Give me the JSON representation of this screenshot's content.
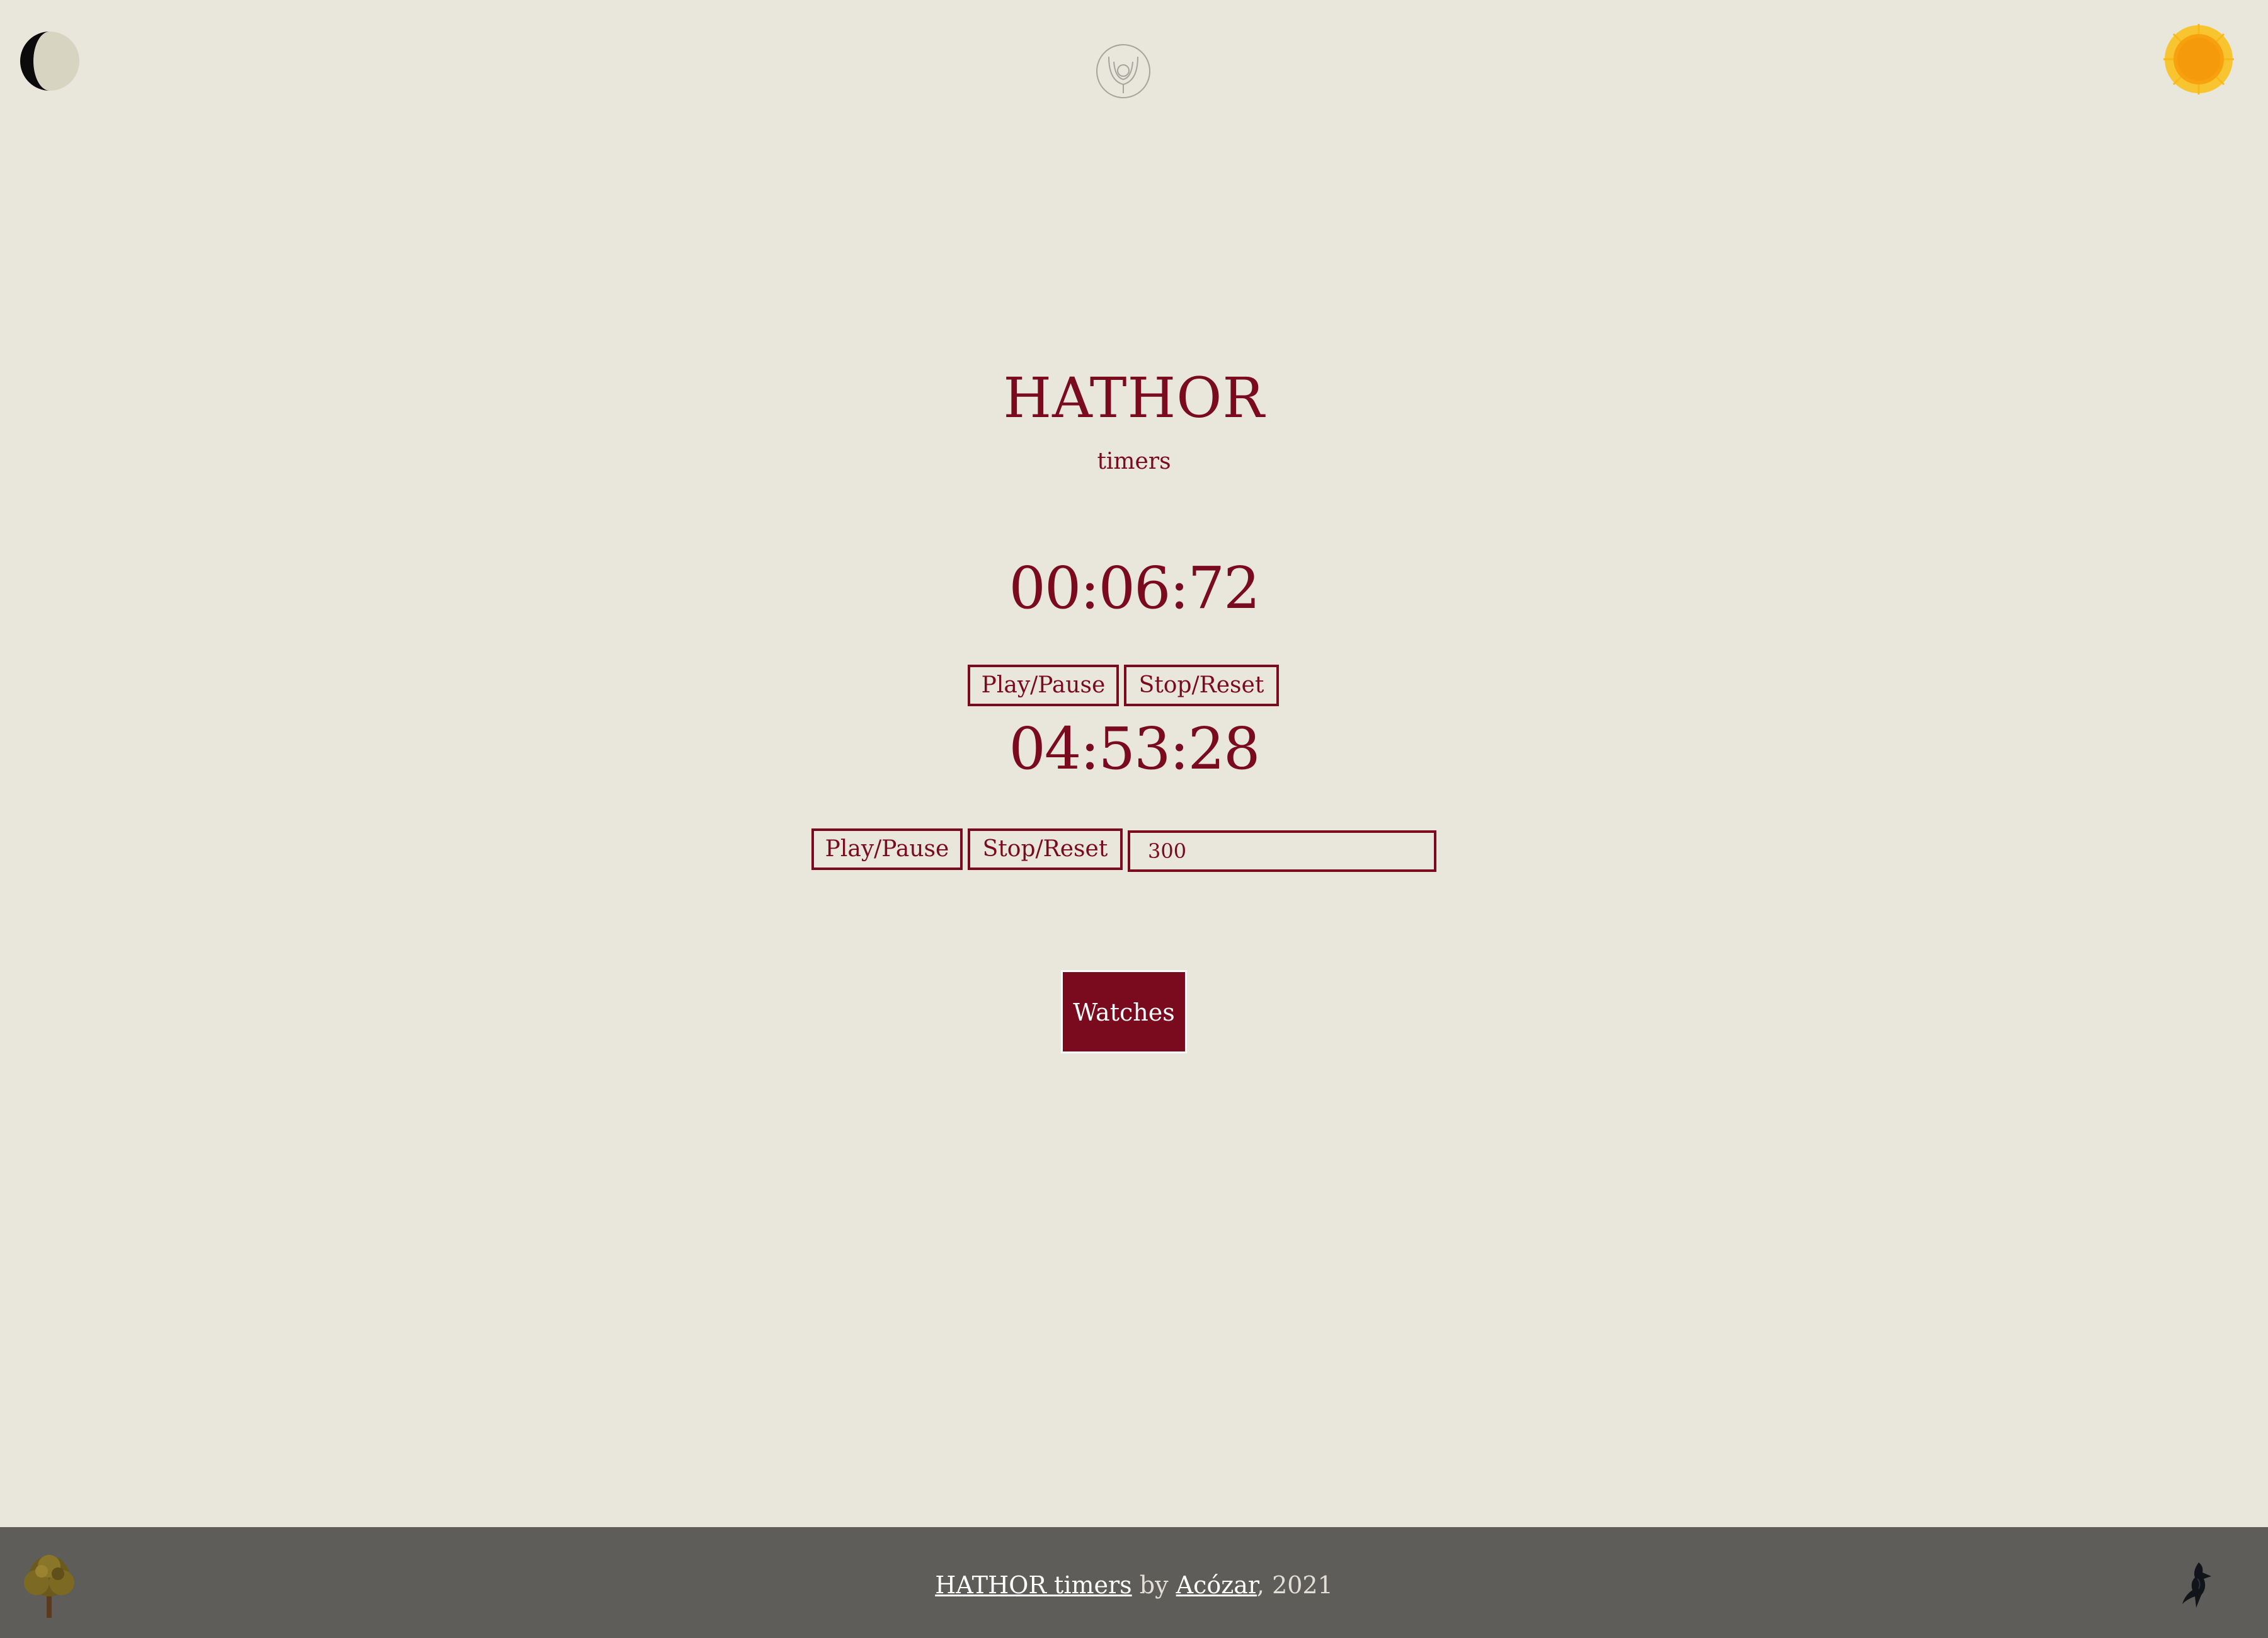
{
  "header": {
    "moon_icon": "half-moon-icon",
    "logo_icon": "hathor-logo-icon",
    "sun_icon": "sun-icon"
  },
  "main": {
    "title": "HATHOR",
    "subtitle": "timers",
    "stopwatch": {
      "display": "00:06:72",
      "play_label": "Play/Pause",
      "stop_label": "Stop/Reset"
    },
    "countdown": {
      "display": "04:53:28",
      "play_label": "Play/Pause",
      "stop_label": "Stop/Reset",
      "input_value": "300"
    },
    "watches_label": "Watches"
  },
  "footer": {
    "link1": "HATHOR timers",
    "by": " by ",
    "link2": "Acózar",
    "year": ", 2021",
    "tree_icon": "tree-icon",
    "bird_icon": "bird-icon"
  },
  "colors": {
    "background": "#e9e6dc",
    "accent": "#7a0a1e",
    "footer": "#5e5d59",
    "sun": "#f7a10f"
  }
}
